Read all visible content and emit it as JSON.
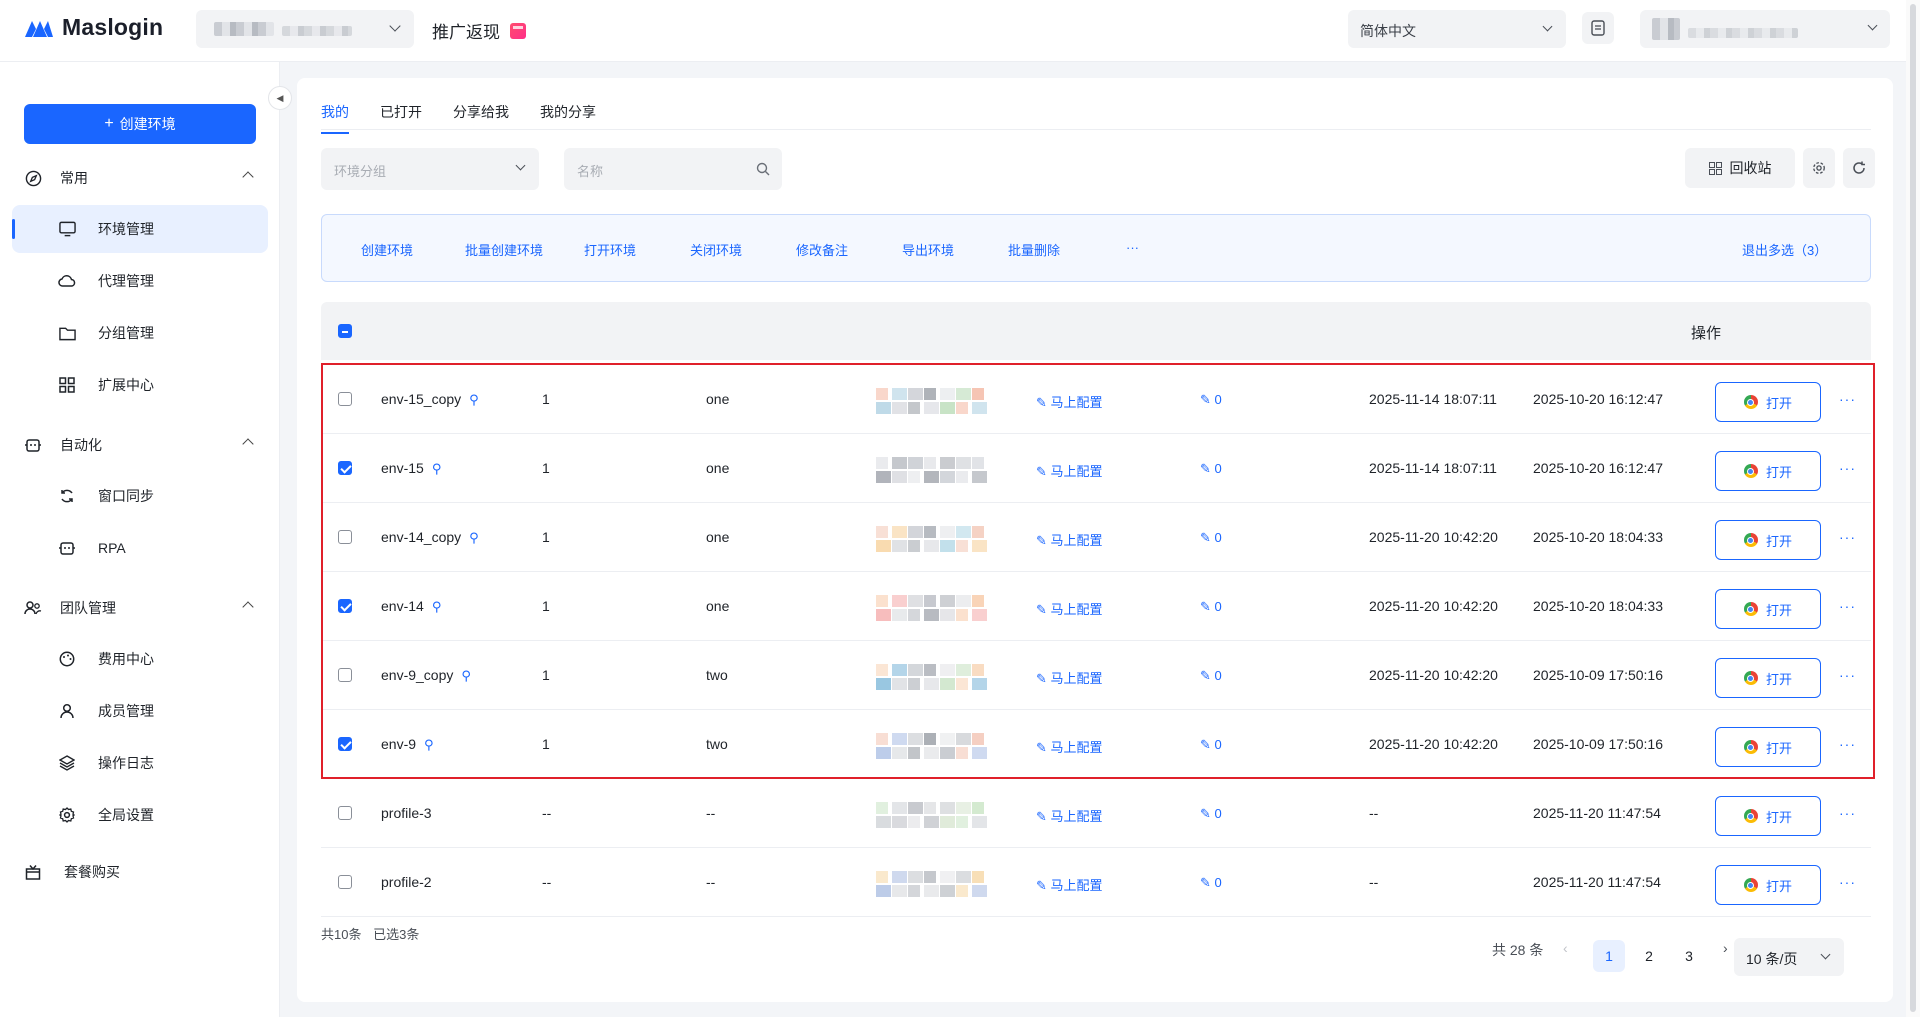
{
  "app": {
    "name": "Maslogin",
    "promo_label": "推广返现",
    "language": "简体中文"
  },
  "sidebar": {
    "create_label": "创建环境",
    "sections": [
      {
        "label": "常用",
        "items": [
          "环境管理",
          "代理管理",
          "分组管理",
          "扩展中心"
        ]
      },
      {
        "label": "自动化",
        "items": [
          "窗口同步",
          "RPA"
        ]
      },
      {
        "label": "团队管理",
        "items": [
          "费用中心",
          "成员管理",
          "操作日志",
          "全局设置"
        ]
      }
    ],
    "package_label": "套餐购买"
  },
  "tabs": [
    "我的",
    "已打开",
    "分享给我",
    "我的分享"
  ],
  "filters": {
    "group_placeholder": "环境分组",
    "name_placeholder": "名称"
  },
  "toolbar": {
    "recycle_label": "回收站"
  },
  "batch_actions": [
    "创建环境",
    "批量创建环境",
    "打开环境",
    "关闭环境",
    "修改备注",
    "导出环境",
    "批量删除",
    "···"
  ],
  "batch_exit_label": "退出多选",
  "batch_count": "（3）",
  "table": {
    "op_header": "操作",
    "config_label": "马上配置",
    "open_label": "打开",
    "more_label": "···",
    "rows": [
      {
        "name": "env-15_copy",
        "pinned": true,
        "col2": "1",
        "col3": "one",
        "remark": "0",
        "time1": "2025-11-14 18:07:11",
        "time2": "2025-10-20 16:12:47",
        "checked": false
      },
      {
        "name": "env-15",
        "pinned": true,
        "col2": "1",
        "col3": "one",
        "remark": "0",
        "time1": "2025-11-14 18:07:11",
        "time2": "2025-10-20 16:12:47",
        "checked": true
      },
      {
        "name": "env-14_copy",
        "pinned": true,
        "col2": "1",
        "col3": "one",
        "remark": "0",
        "time1": "2025-11-20 10:42:20",
        "time2": "2025-10-20 18:04:33",
        "checked": false
      },
      {
        "name": "env-14",
        "pinned": true,
        "col2": "1",
        "col3": "one",
        "remark": "0",
        "time1": "2025-11-20 10:42:20",
        "time2": "2025-10-20 18:04:33",
        "checked": true
      },
      {
        "name": "env-9_copy",
        "pinned": true,
        "col2": "1",
        "col3": "two",
        "remark": "0",
        "time1": "2025-11-20 10:42:20",
        "time2": "2025-10-09 17:50:16",
        "checked": false
      },
      {
        "name": "env-9",
        "pinned": true,
        "col2": "1",
        "col3": "two",
        "remark": "0",
        "time1": "2025-11-20 10:42:20",
        "time2": "2025-10-09 17:50:16",
        "checked": true
      },
      {
        "name": "profile-3",
        "pinned": false,
        "col2": "--",
        "col3": "--",
        "remark": "0",
        "time1": "--",
        "time2": "2025-11-20 11:47:54",
        "checked": false
      },
      {
        "name": "profile-2",
        "pinned": false,
        "col2": "--",
        "col3": "--",
        "remark": "0",
        "time1": "--",
        "time2": "2025-11-20 11:47:54",
        "checked": false
      }
    ]
  },
  "footer": {
    "count_label": "共10条",
    "selected_label": "已选3条"
  },
  "pagination": {
    "total_label": "共 28 条",
    "pages": [
      "1",
      "2",
      "3"
    ],
    "current": "1",
    "page_size": "10 条/页"
  },
  "colors": {
    "accent": "#1a66ff",
    "highlight": "#e0202a"
  }
}
